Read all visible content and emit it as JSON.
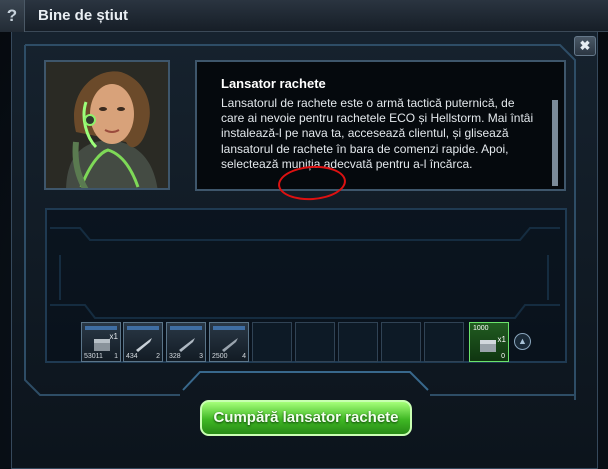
{
  "header": {
    "help_label": "?",
    "title": "Bine de știut",
    "close_label": "✖"
  },
  "info": {
    "title": "Lansator rachete",
    "body": "Lansatorul de rachete este o armă tactică puternică, de care ai nevoie pentru rachetele ECO și Hellstorm. Mai întâi instalează-l pe nava ta, accesează clientul, și glisează lansatorul de rachete în bara de comenzi rapide. Apoi, selectează muniția adecvată pentru a-l încărca."
  },
  "hotbar": {
    "slots": [
      {
        "quantity": "x1",
        "count": "53011",
        "key": "1",
        "icon": "crate-icon"
      },
      {
        "quantity": "",
        "count": "434",
        "key": "2",
        "icon": "rocket-icon"
      },
      {
        "quantity": "",
        "count": "328",
        "key": "3",
        "icon": "rocket-icon"
      },
      {
        "quantity": "",
        "count": "2500",
        "key": "4",
        "icon": "rocket-icon"
      }
    ],
    "launcher_slot": {
      "top_count": "1000",
      "quantity": "x1",
      "key": "0",
      "icon": "crate-icon"
    },
    "up_arrow": "▲"
  },
  "buy_button": "Cumpără lansator rachete",
  "colors": {
    "accent_green": "#3fb824",
    "frame_blue": "#3e566b",
    "highlight_circle": "#dd1111"
  }
}
